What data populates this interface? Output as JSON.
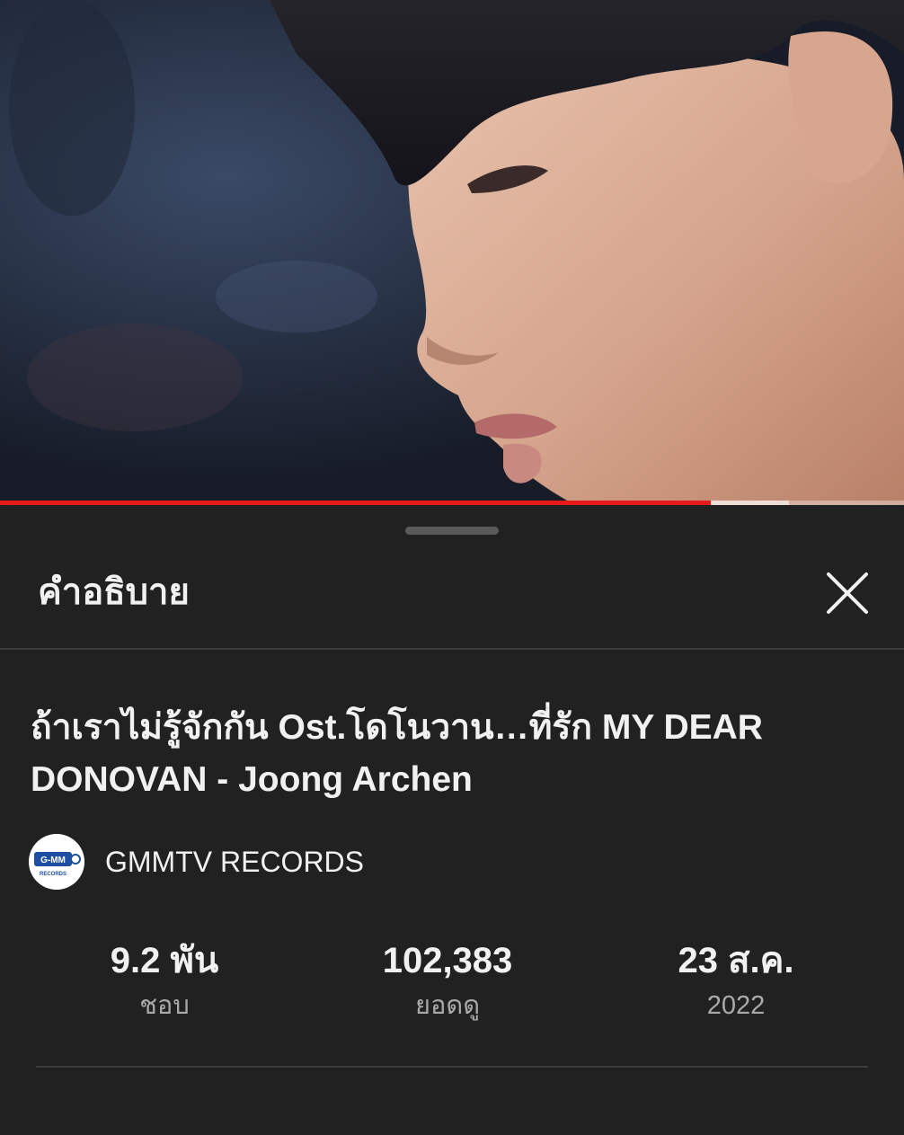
{
  "video": {
    "progress_played": 0.786,
    "progress_buffered": 0.873
  },
  "sheet": {
    "title": "คำอธิบาย"
  },
  "video_info": {
    "title": "ถ้าเราไม่รู้จักกัน Ost.โดโนวาน…ที่รัก MY DEAR DONOVAN - Joong Archen",
    "channel": {
      "name": "GMMTV RECORDS",
      "avatar_logo_text": "G-MM",
      "avatar_logo_sub": "RECORDS"
    },
    "stats": {
      "likes_value": "9.2 พัน",
      "likes_label": "ชอบ",
      "views_value": "102,383",
      "views_label": "ยอดดู",
      "date_value": "23 ส.ค.",
      "date_label": "2022"
    }
  },
  "colors": {
    "background": "#212121",
    "progress": "#e8191a",
    "text_primary": "#f1f1f1",
    "text_secondary": "#aaaaaa"
  }
}
